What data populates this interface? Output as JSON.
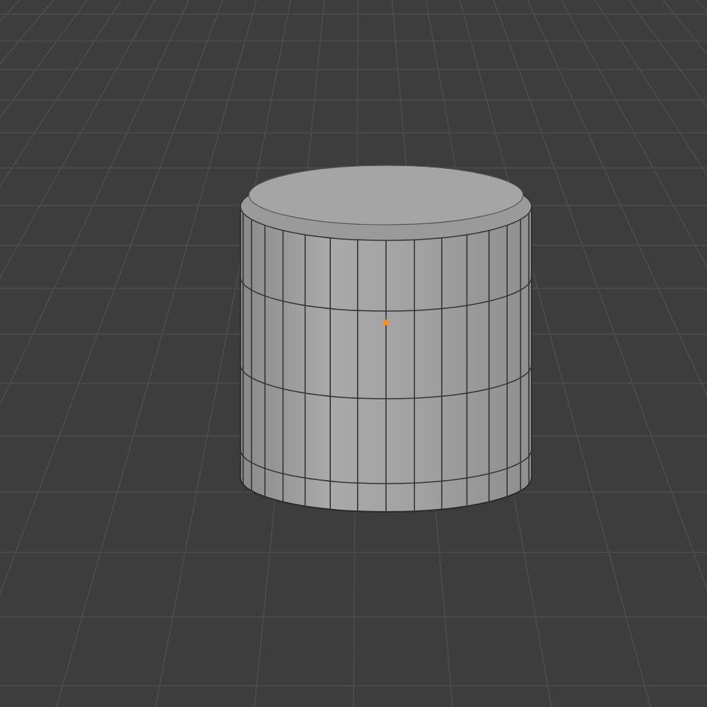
{
  "viewport": {
    "objects": [
      {
        "kind": "cylinder"
      }
    ]
  }
}
